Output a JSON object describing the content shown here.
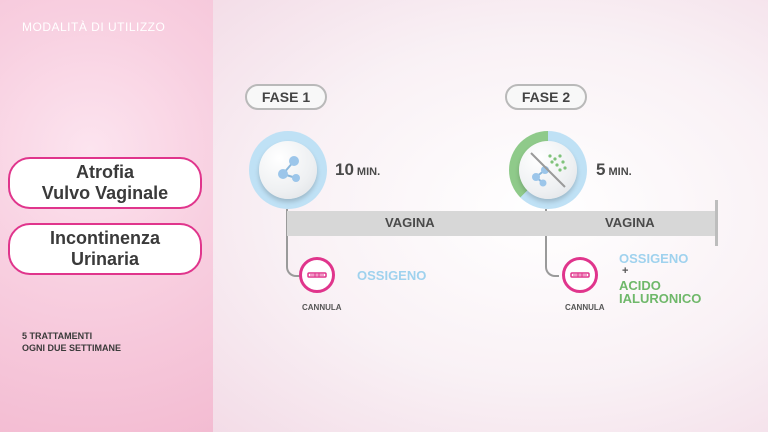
{
  "header": {
    "title": "MODALITÀ DI UTILIZZO"
  },
  "conditions": [
    {
      "lines": [
        "Atrofia",
        "Vulvo Vaginale"
      ]
    },
    {
      "lines": [
        "Incontinenza",
        "Urinaria"
      ]
    }
  ],
  "note": {
    "lines": [
      "5 TRATTAMENTI",
      "OGNI DUE SETTIMANE"
    ]
  },
  "phases": [
    {
      "label": "FASE 1",
      "duration": "10",
      "unit": "MIN.",
      "area": "VAGINA",
      "device": "CANNULA",
      "substances": [
        "OSSIGENO"
      ]
    },
    {
      "label": "FASE 2",
      "duration": "5",
      "unit": "MIN.",
      "area": "VAGINA",
      "device": "CANNULA",
      "substances": [
        "OSSIGENO",
        "+",
        "ACIDO",
        "IALURONICO"
      ]
    }
  ],
  "colors": {
    "accent": "#e0358c",
    "oxygen": "#9fd2ee",
    "hyaluronic": "#6fb86a"
  },
  "icons": {
    "phase1": "molecule-icon",
    "phase2": "molecule-crossed-icon",
    "device": "cannula-icon"
  }
}
